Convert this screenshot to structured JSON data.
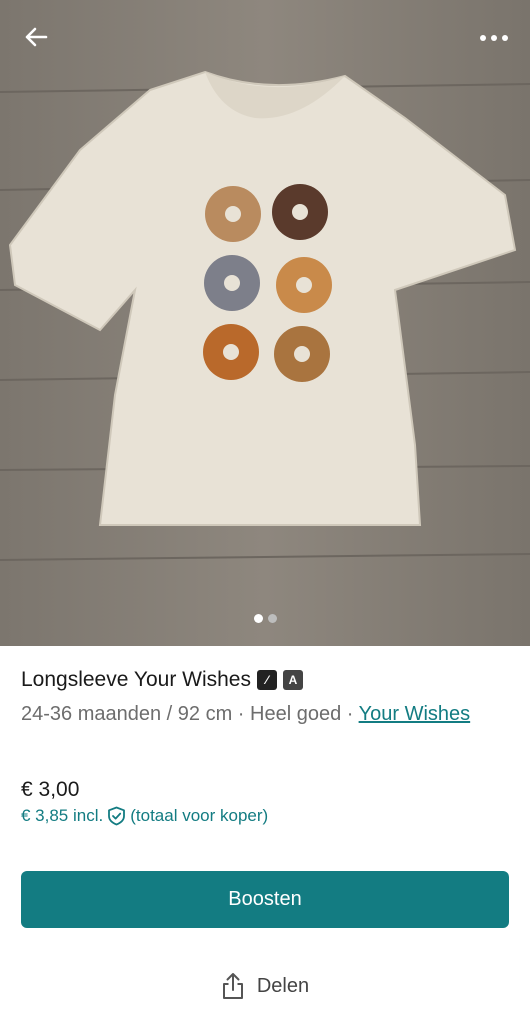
{
  "header": {
    "back_icon": "arrow-left-icon",
    "more_icon": "more-horizontal-icon"
  },
  "gallery": {
    "image_count": 2,
    "active_index": 0
  },
  "product": {
    "title": "Longsleeve Your Wishes",
    "meta_text": "24-36 maanden / 92 cm · Heel goed · ",
    "brand_link": "Your Wishes"
  },
  "pricing": {
    "price": "€ 3,00",
    "price_incl": "€ 3,85 incl.",
    "buyer_note": "(totaal voor koper)"
  },
  "actions": {
    "boost_label": "Boosten",
    "share_label": "Delen"
  },
  "colors": {
    "accent": "#137c82"
  }
}
